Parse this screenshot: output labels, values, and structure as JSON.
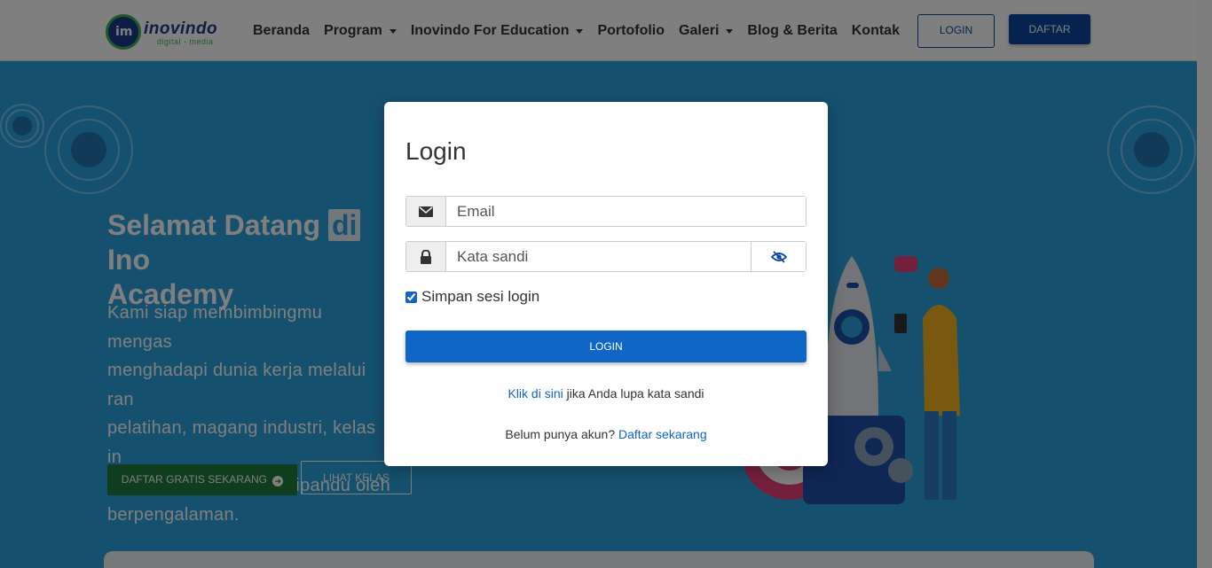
{
  "brand": {
    "name": "inovindo",
    "tagline": "digital - media",
    "mark": "im"
  },
  "nav": {
    "items": [
      {
        "label": "Beranda",
        "dropdown": false
      },
      {
        "label": "Program",
        "dropdown": true
      },
      {
        "label": "Inovindo For Education",
        "dropdown": true
      },
      {
        "label": "Portofolio",
        "dropdown": false
      },
      {
        "label": "Galeri",
        "dropdown": true
      },
      {
        "label": "Blog & Berita",
        "dropdown": false
      },
      {
        "label": "Kontak",
        "dropdown": false
      }
    ],
    "login_label": "LOGIN",
    "register_label": "DAFTAR"
  },
  "hero": {
    "title_part1": "Selamat Datang",
    "title_highlight": "di",
    "title_part2": "Ino",
    "title_line2": "Academy",
    "text_lines": [
      "Kami siap membimbingmu mengas",
      "menghadapi dunia kerja melalui ran",
      "pelatihan, magang industri, kelas in",
      "menarik lainnya yang dipandu oleh",
      "berpengalaman."
    ],
    "cta_primary": "DAFTAR GRATIS SEKARANG",
    "cta_secondary": "LIHAT KELAS"
  },
  "modal": {
    "title": "Login",
    "email_placeholder": "Email",
    "password_placeholder": "Kata sandi",
    "remember_label": "Simpan sesi login",
    "remember_checked": true,
    "submit_label": "LOGIN",
    "forgot_link": "Klik di sini",
    "forgot_text": "jika Anda lupa kata sandi",
    "register_prompt": "Belum punya akun?",
    "register_link": "Daftar sekarang"
  },
  "colors": {
    "primary": "#1066c6",
    "hero_bg": "#2aa3df",
    "brand_green": "#3fb34f",
    "brand_blue": "#1b3b8a"
  }
}
